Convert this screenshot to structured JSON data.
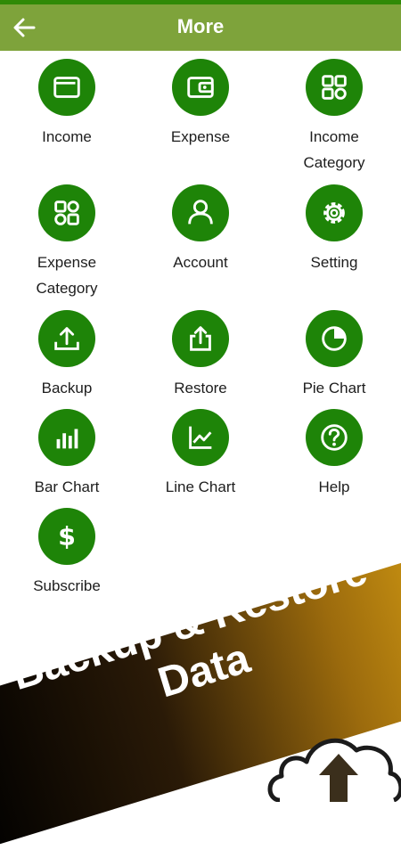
{
  "appbar": {
    "title": "More",
    "back_icon": "arrow-left-icon"
  },
  "menu": [
    {
      "label": "Income",
      "icon": "wallet-icon"
    },
    {
      "label": "Expense",
      "icon": "wallet-outline-icon"
    },
    {
      "label": "Income\nCategory",
      "icon": "category-grid-icon"
    },
    {
      "label": "Expense\nCategory",
      "icon": "category-grid-icon"
    },
    {
      "label": "Account",
      "icon": "person-icon"
    },
    {
      "label": "Setting",
      "icon": "gear-icon"
    },
    {
      "label": "Backup",
      "icon": "upload-tray-icon"
    },
    {
      "label": "Restore",
      "icon": "share-upload-icon"
    },
    {
      "label": "Pie Chart",
      "icon": "pie-chart-icon"
    },
    {
      "label": "Bar Chart",
      "icon": "bar-chart-icon"
    },
    {
      "label": "Line Chart",
      "icon": "line-chart-icon"
    },
    {
      "label": "Help",
      "icon": "help-icon"
    },
    {
      "label": "Subscribe",
      "icon": "dollar-icon"
    }
  ],
  "promo": {
    "line1": "Backup & Restore",
    "line2": "Data",
    "icon": "cloud-upload-icon"
  },
  "colors": {
    "accent": "#1e8408",
    "appbar": "#7ea33b",
    "status": "#2f8a06"
  }
}
